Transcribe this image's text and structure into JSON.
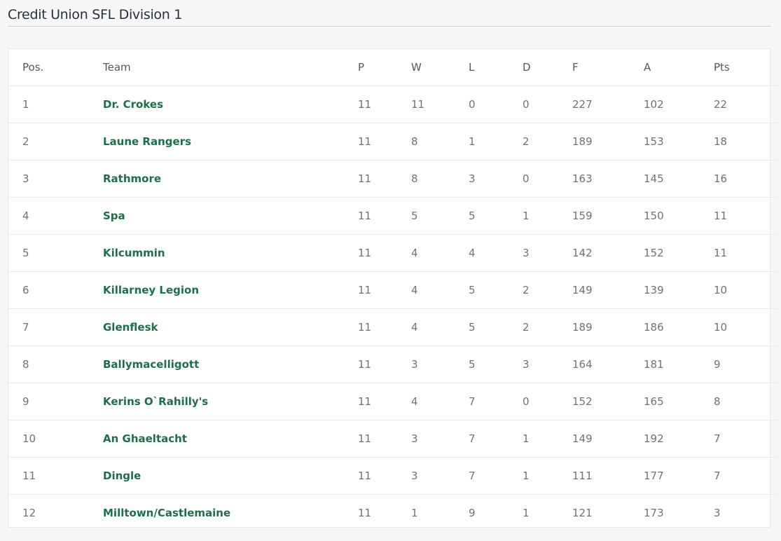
{
  "page": {
    "title": "Credit Union SFL Division 1"
  },
  "table": {
    "headers": {
      "pos": "Pos.",
      "team": "Team",
      "p": "P",
      "w": "W",
      "l": "L",
      "d": "D",
      "f": "F",
      "a": "A",
      "pts": "Pts"
    },
    "rows": [
      {
        "pos": "1",
        "team": "Dr. Crokes",
        "p": "11",
        "w": "11",
        "l": "0",
        "d": "0",
        "f": "227",
        "a": "102",
        "pts": "22"
      },
      {
        "pos": "2",
        "team": "Laune Rangers",
        "p": "11",
        "w": "8",
        "l": "1",
        "d": "2",
        "f": "189",
        "a": "153",
        "pts": "18"
      },
      {
        "pos": "3",
        "team": "Rathmore",
        "p": "11",
        "w": "8",
        "l": "3",
        "d": "0",
        "f": "163",
        "a": "145",
        "pts": "16"
      },
      {
        "pos": "4",
        "team": "Spa",
        "p": "11",
        "w": "5",
        "l": "5",
        "d": "1",
        "f": "159",
        "a": "150",
        "pts": "11"
      },
      {
        "pos": "5",
        "team": "Kilcummin",
        "p": "11",
        "w": "4",
        "l": "4",
        "d": "3",
        "f": "142",
        "a": "152",
        "pts": "11"
      },
      {
        "pos": "6",
        "team": "Killarney Legion",
        "p": "11",
        "w": "4",
        "l": "5",
        "d": "2",
        "f": "149",
        "a": "139",
        "pts": "10"
      },
      {
        "pos": "7",
        "team": "Glenflesk",
        "p": "11",
        "w": "4",
        "l": "5",
        "d": "2",
        "f": "189",
        "a": "186",
        "pts": "10"
      },
      {
        "pos": "8",
        "team": "Ballymacelligott",
        "p": "11",
        "w": "3",
        "l": "5",
        "d": "3",
        "f": "164",
        "a": "181",
        "pts": "9"
      },
      {
        "pos": "9",
        "team": "Kerins O`Rahilly's",
        "p": "11",
        "w": "4",
        "l": "7",
        "d": "0",
        "f": "152",
        "a": "165",
        "pts": "8"
      },
      {
        "pos": "10",
        "team": "An Ghaeltacht",
        "p": "11",
        "w": "3",
        "l": "7",
        "d": "1",
        "f": "149",
        "a": "192",
        "pts": "7"
      },
      {
        "pos": "11",
        "team": "Dingle",
        "p": "11",
        "w": "3",
        "l": "7",
        "d": "1",
        "f": "111",
        "a": "177",
        "pts": "7"
      },
      {
        "pos": "12",
        "team": "Milltown/Castlemaine",
        "p": "11",
        "w": "1",
        "l": "9",
        "d": "1",
        "f": "121",
        "a": "173",
        "pts": "3"
      }
    ]
  },
  "colors": {
    "team_link": "#1f6e4a",
    "background": "#f6f7f9"
  }
}
